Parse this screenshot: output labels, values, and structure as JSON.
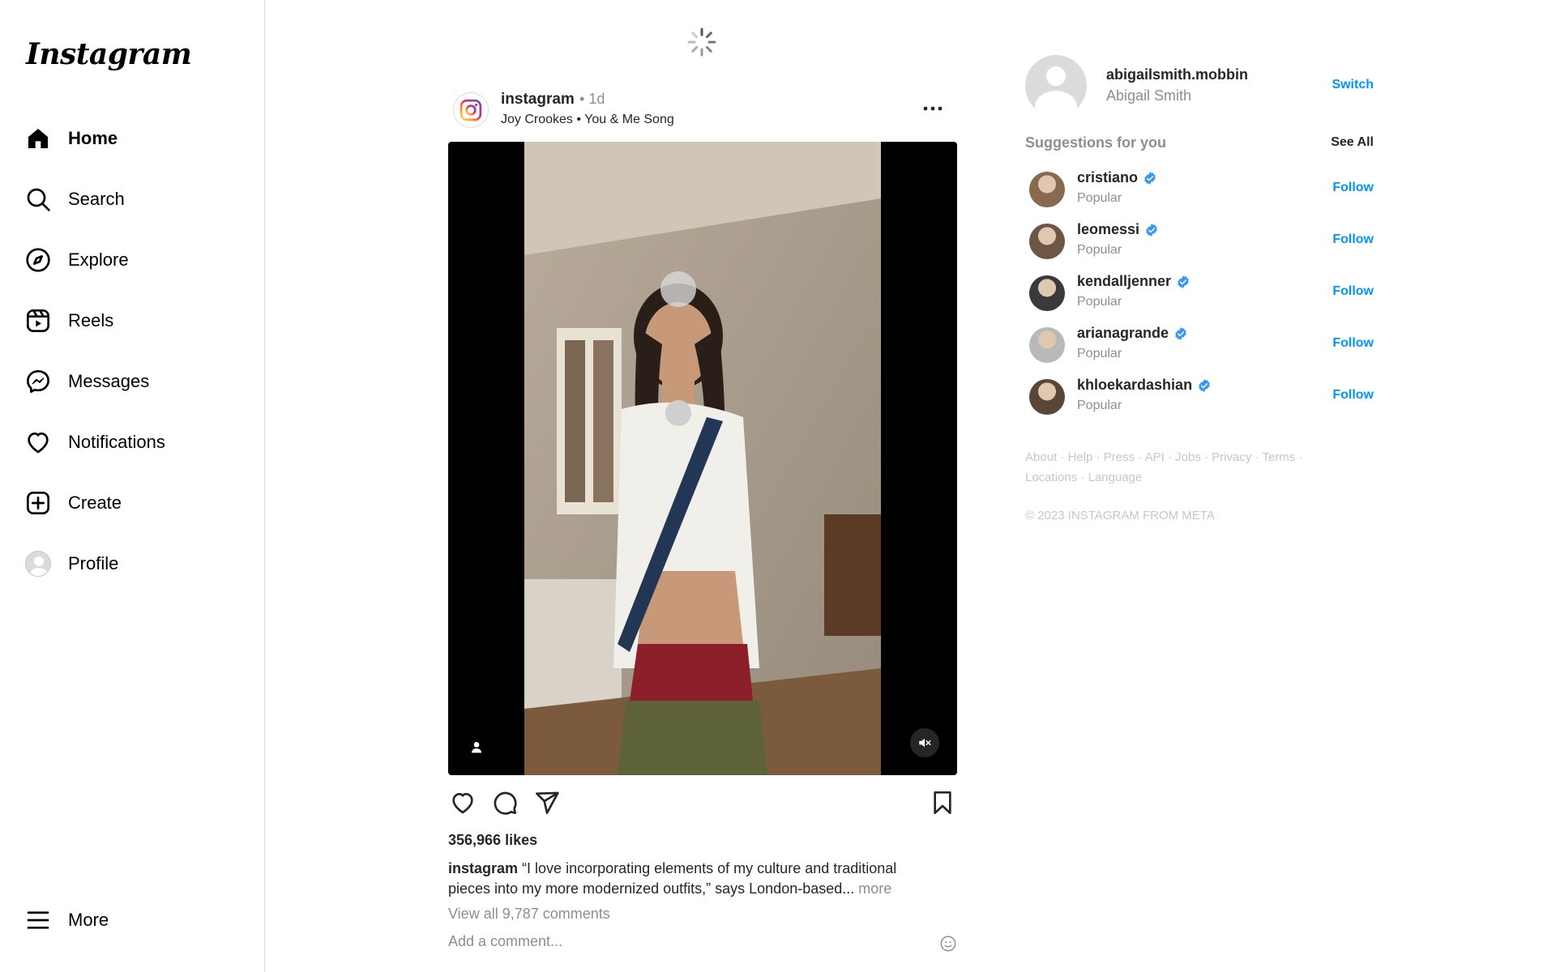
{
  "app": {
    "logo_text": "Instagram"
  },
  "sidebar": {
    "items": [
      {
        "label": "Home",
        "icon": "home-icon",
        "active": true
      },
      {
        "label": "Search",
        "icon": "search-icon"
      },
      {
        "label": "Explore",
        "icon": "compass-icon"
      },
      {
        "label": "Reels",
        "icon": "reels-icon"
      },
      {
        "label": "Messages",
        "icon": "messenger-icon"
      },
      {
        "label": "Notifications",
        "icon": "heart-icon"
      },
      {
        "label": "Create",
        "icon": "plus-square-icon"
      },
      {
        "label": "Profile",
        "icon": "avatar"
      }
    ],
    "more_label": "More"
  },
  "post": {
    "username": "instagram",
    "time": "1d",
    "audio_artist": "Joy Crookes",
    "audio_separator": "•",
    "audio_song": "You & Me Song",
    "likes": "356,966 likes",
    "caption_user": "instagram",
    "caption_text": "“I love incorporating elements of my culture and traditional pieces into my more modernized outfits,” says London-based...",
    "caption_more": "more",
    "view_comments": "View all 9,787 comments",
    "comment_placeholder": "Add a comment..."
  },
  "profile": {
    "username": "abigailsmith.mobbin",
    "name": "Abigail Smith",
    "switch_label": "Switch"
  },
  "suggestions": {
    "heading": "Suggestions for you",
    "see_all": "See All",
    "follow_label": "Follow",
    "items": [
      {
        "username": "cristiano",
        "sub": "Popular",
        "color": "#8a6a4f"
      },
      {
        "username": "leomessi",
        "sub": "Popular",
        "color": "#6e5646"
      },
      {
        "username": "kendalljenner",
        "sub": "Popular",
        "color": "#3a3a3a"
      },
      {
        "username": "arianagrande",
        "sub": "Popular",
        "color": "#b9b9b9"
      },
      {
        "username": "khloekardashian",
        "sub": "Popular",
        "color": "#5a4636"
      }
    ]
  },
  "footer": {
    "links": [
      "About",
      "Help",
      "Press",
      "API",
      "Jobs",
      "Privacy",
      "Terms",
      "Locations",
      "Language"
    ],
    "separator": "·",
    "copyright": "© 2023 INSTAGRAM FROM META"
  },
  "colors": {
    "accent": "#0095f6",
    "verified": "#3897f0",
    "muted": "#8e8e8e",
    "border": "#dbdbdb"
  }
}
